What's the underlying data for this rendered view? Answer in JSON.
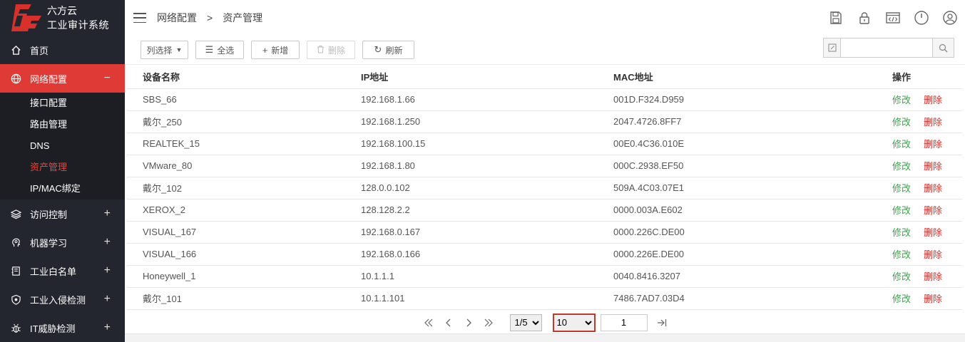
{
  "brand": {
    "line1": "六方云",
    "line2": "工业审计系统"
  },
  "colors": {
    "accent": "#e03a36",
    "sidebar": "#23262e",
    "edit": "#3aa54b",
    "delete": "#e0302c"
  },
  "nav": {
    "home": "首页",
    "network": "网络配置",
    "network_sub": [
      "接口配置",
      "路由管理",
      "DNS",
      "资产管理",
      "IP/MAC绑定"
    ],
    "access": "访问控制",
    "ml": "机器学习",
    "whitelist": "工业白名单",
    "intrusion": "工业入侵检测",
    "it_threat": "IT威胁检测",
    "minus": "−",
    "plus": "+"
  },
  "breadcrumb": {
    "parent": "网络配置",
    "sep": ">",
    "current": "资产管理"
  },
  "toolbar": {
    "columns": "列选择",
    "select_all": "全选",
    "add": "新增",
    "delete": "删除",
    "refresh": "刷新",
    "search_value": ""
  },
  "table": {
    "headers": [
      "设备名称",
      "IP地址",
      "MAC地址",
      "操作"
    ],
    "edit_label": "修改",
    "delete_label": "删除",
    "rows": [
      [
        "SBS_66",
        "192.168.1.66",
        "001D.F324.D959"
      ],
      [
        "戴尔_250",
        "192.168.1.250",
        "2047.4726.8FF7"
      ],
      [
        "REALTEK_15",
        "192.168.100.15",
        "00E0.4C36.010E"
      ],
      [
        "VMware_80",
        "192.168.1.80",
        "000C.2938.EF50"
      ],
      [
        "戴尔_102",
        "128.0.0.102",
        "509A.4C03.07E1"
      ],
      [
        "XEROX_2",
        "128.128.2.2",
        "0000.003A.E602"
      ],
      [
        "VISUAL_167",
        "192.168.0.167",
        "0000.226C.DE00"
      ],
      [
        "VISUAL_166",
        "192.168.0.166",
        "0000.226E.DE00"
      ],
      [
        "Honeywell_1",
        "10.1.1.1",
        "0040.8416.3207"
      ],
      [
        "戴尔_101",
        "10.1.1.101",
        "7486.7AD7.03D4"
      ]
    ]
  },
  "pagination": {
    "page_select": "1/5",
    "page_size": "10",
    "page_input": "1"
  }
}
